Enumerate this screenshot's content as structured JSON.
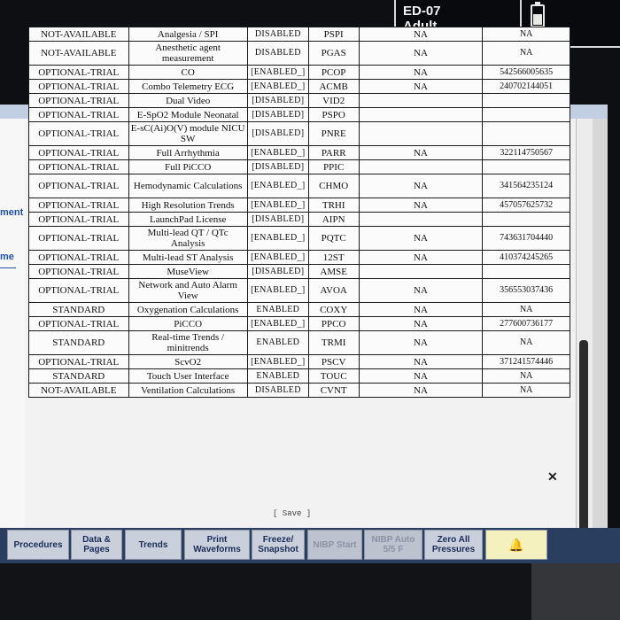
{
  "patient": {
    "bed": "ED-07",
    "category": "Adult"
  },
  "sidebar_fragments": [
    "ment",
    "me"
  ],
  "table": {
    "rows": [
      {
        "status": "NOT-AVAILABLE",
        "feature": "Analgesia / SPI",
        "state": "DISABLED",
        "code": "PSPI",
        "na": "NA",
        "serial": "NA"
      },
      {
        "status": "NOT-AVAILABLE",
        "feature": "Anesthetic agent measurement",
        "state": "DISABLED",
        "code": "PGAS",
        "na": "NA",
        "serial": "NA",
        "tall": true
      },
      {
        "status": "OPTIONAL-TRIAL",
        "feature": "CO",
        "state": "[ENABLED_]",
        "code": "PCOP",
        "na": "NA",
        "serial": "542566005635"
      },
      {
        "status": "OPTIONAL-TRIAL",
        "feature": "Combo Telemetry ECG",
        "state": "[ENABLED_]",
        "code": "ACMB",
        "na": "NA",
        "serial": "240702144051"
      },
      {
        "status": "OPTIONAL-TRIAL",
        "feature": "Dual Video",
        "state": "[DISABLED]",
        "code": "VID2",
        "na": "",
        "serial": ""
      },
      {
        "status": "OPTIONAL-TRIAL",
        "feature": "E-SpO2 Module Neonatal",
        "state": "[DISABLED]",
        "code": "PSPO",
        "na": "",
        "serial": ""
      },
      {
        "status": "OPTIONAL-TRIAL",
        "feature": "E-sC(Ai)O(V) module NICU SW",
        "state": "[DISABLED]",
        "code": "PNRE",
        "na": "",
        "serial": "",
        "tall": true
      },
      {
        "status": "OPTIONAL-TRIAL",
        "feature": "Full Arrhythmia",
        "state": "[ENABLED_]",
        "code": "PARR",
        "na": "NA",
        "serial": "322114750567"
      },
      {
        "status": "OPTIONAL-TRIAL",
        "feature": "Full PiCCO",
        "state": "[DISABLED]",
        "code": "PPIC",
        "na": "",
        "serial": ""
      },
      {
        "status": "OPTIONAL-TRIAL",
        "feature": "Hemodynamic Calculations",
        "state": "[ENABLED_]",
        "code": "CHMO",
        "na": "NA",
        "serial": "341564235124",
        "tall": true
      },
      {
        "status": "OPTIONAL-TRIAL",
        "feature": "High Resolution Trends",
        "state": "[ENABLED_]",
        "code": "TRHI",
        "na": "NA",
        "serial": "457057625732"
      },
      {
        "status": "OPTIONAL-TRIAL",
        "feature": "LaunchPad License",
        "state": "[DISABLED]",
        "code": "AIPN",
        "na": "",
        "serial": ""
      },
      {
        "status": "OPTIONAL-TRIAL",
        "feature": "Multi-lead QT / QTc Analysis",
        "state": "[ENABLED_]",
        "code": "PQTC",
        "na": "NA",
        "serial": "743631704440",
        "tall": true
      },
      {
        "status": "OPTIONAL-TRIAL",
        "feature": "Multi-lead ST Analysis",
        "state": "[ENABLED_]",
        "code": "12ST",
        "na": "NA",
        "serial": "410374245265"
      },
      {
        "status": "OPTIONAL-TRIAL",
        "feature": "MuseView",
        "state": "[DISABLED]",
        "code": "AMSE",
        "na": "",
        "serial": ""
      },
      {
        "status": "OPTIONAL-TRIAL",
        "feature": "Network and Auto Alarm View",
        "state": "[ENABLED_]",
        "code": "AVOA",
        "na": "NA",
        "serial": "356553037436",
        "tall": true
      },
      {
        "status": "STANDARD",
        "feature": "Oxygenation Calculations",
        "state": "ENABLED",
        "code": "COXY",
        "na": "NA",
        "serial": "NA"
      },
      {
        "status": "OPTIONAL-TRIAL",
        "feature": "PiCCO",
        "state": "[ENABLED_]",
        "code": "PPCO",
        "na": "NA",
        "serial": "277600736177"
      },
      {
        "status": "STANDARD",
        "feature": "Real-time Trends / minitrends",
        "state": "ENABLED",
        "code": "TRMI",
        "na": "NA",
        "serial": "NA",
        "tall": true
      },
      {
        "status": "OPTIONAL-TRIAL",
        "feature": "ScvO2",
        "state": "[ENABLED_]",
        "code": "PSCV",
        "na": "NA",
        "serial": "371241574446"
      },
      {
        "status": "STANDARD",
        "feature": "Touch User Interface",
        "state": "ENABLED",
        "code": "TOUC",
        "na": "NA",
        "serial": "NA"
      },
      {
        "status": "NOT-AVAILABLE",
        "feature": "Ventilation Calculations",
        "state": "DISABLED",
        "code": "CVNT",
        "na": "NA",
        "serial": "NA"
      }
    ]
  },
  "save_label": "[ Save ]",
  "toolbar": {
    "procedures": "Procedures",
    "data_pages": "Data & Pages",
    "trends": "Trends",
    "print_waveforms": "Print Waveforms",
    "freeze_snapshot": "Freeze/ Snapshot",
    "nibp_start": "NIBP Start",
    "nibp_auto": "NIBP Auto 5/5 F",
    "zero_all": "Zero All Pressures",
    "alarm_icon": "bell-icon"
  }
}
